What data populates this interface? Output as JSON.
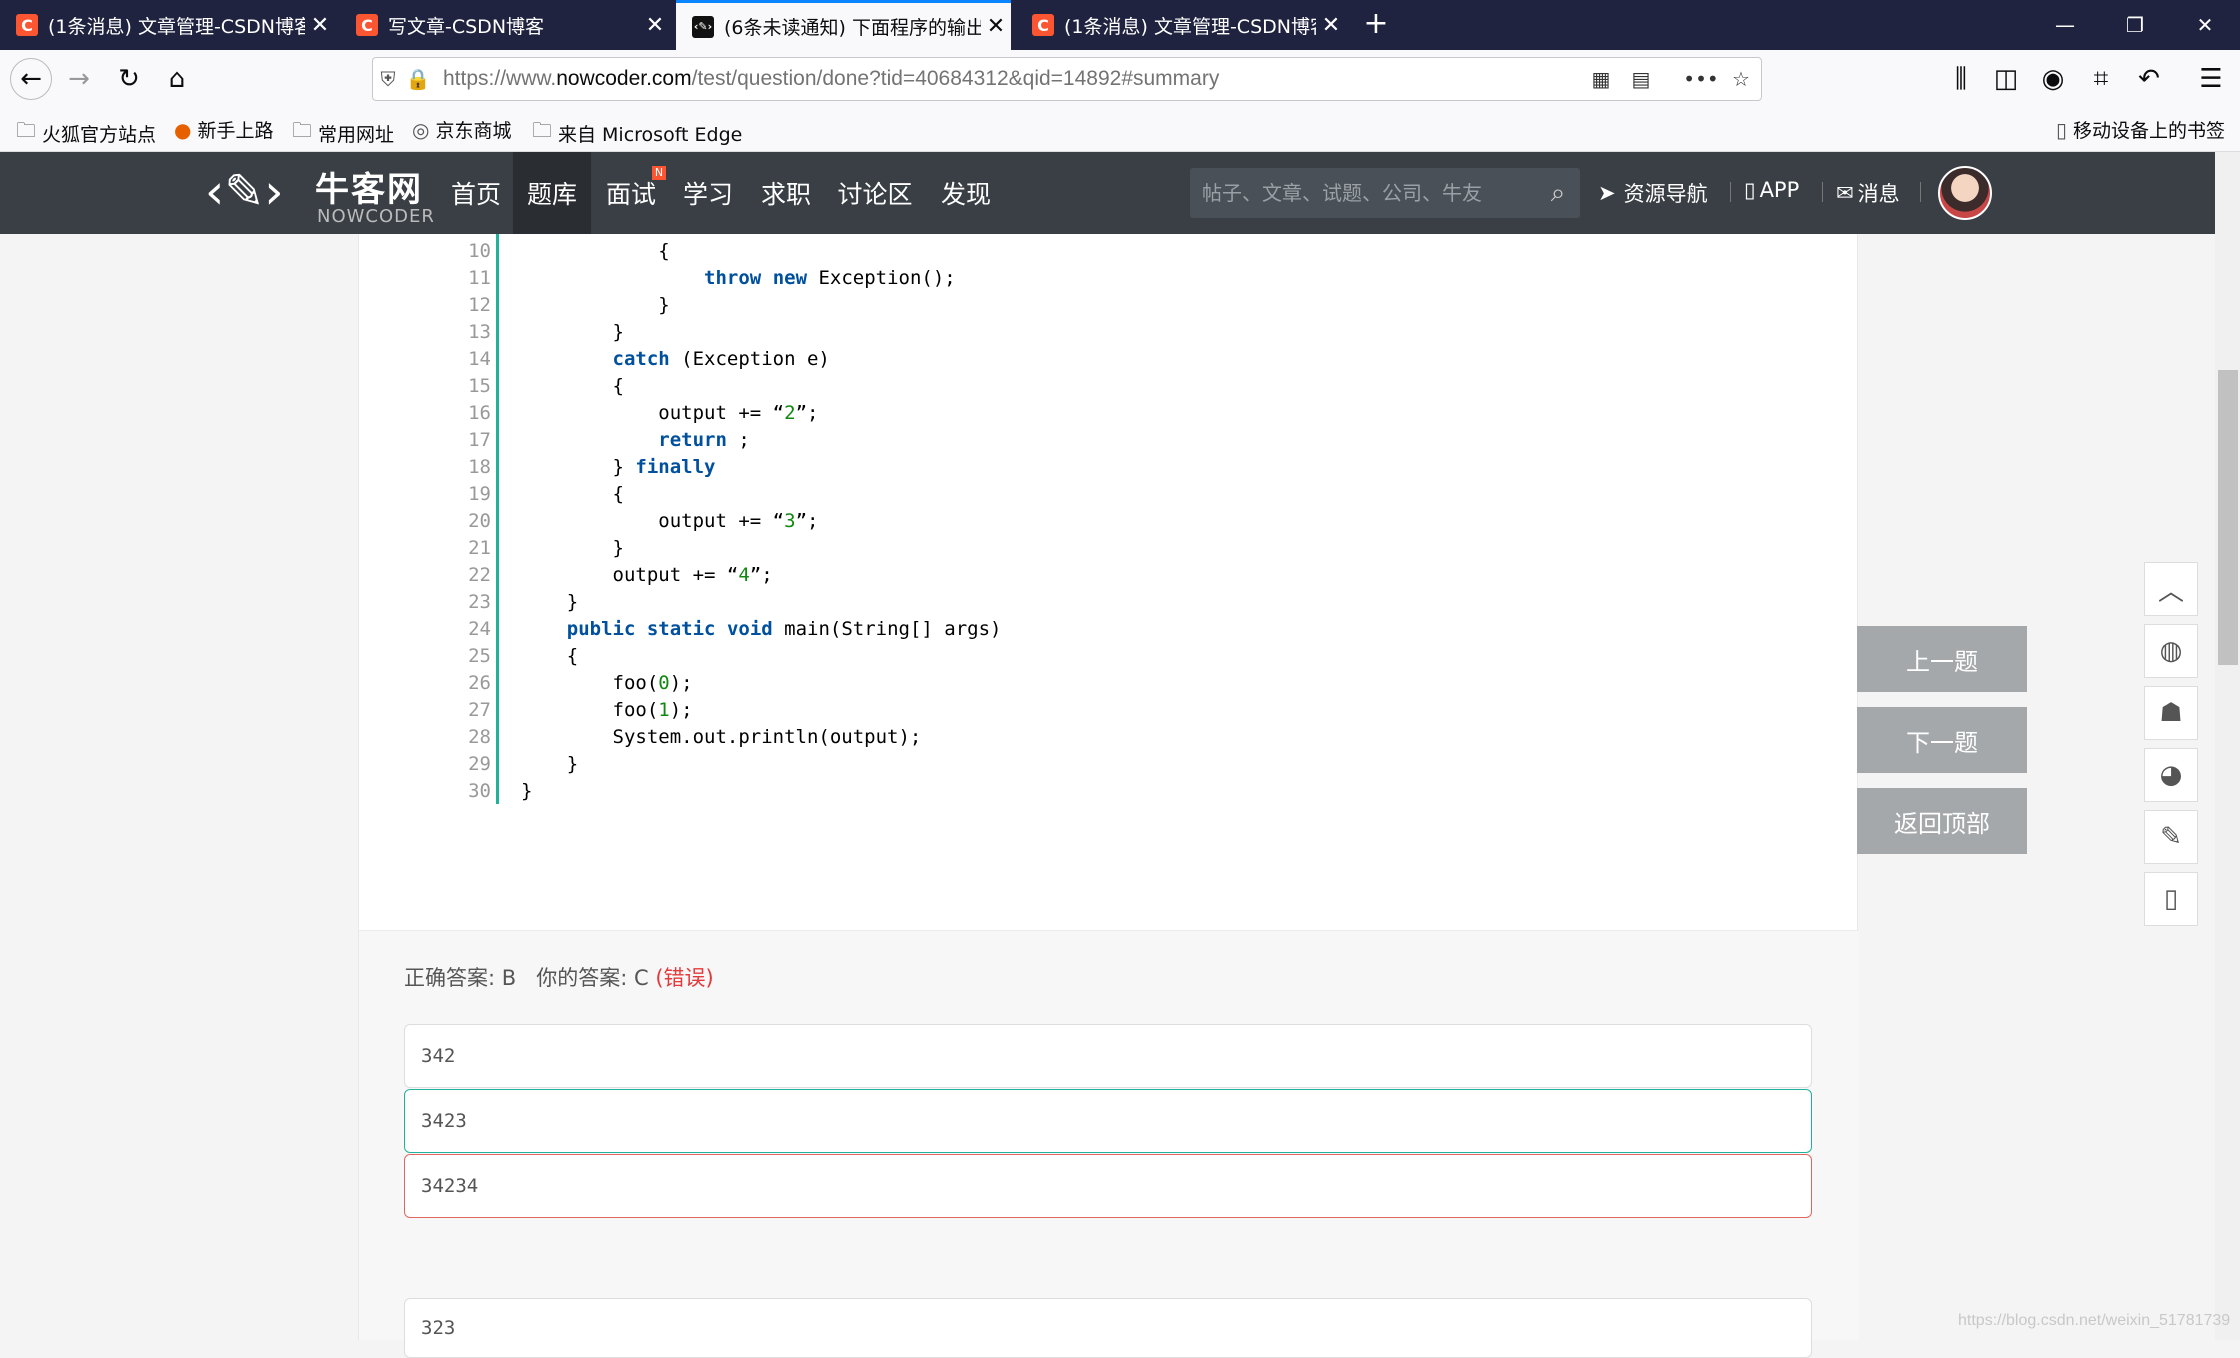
{
  "browser": {
    "tabs": [
      {
        "title": "(1条消息) 文章管理-CSDN博客",
        "icon": "C"
      },
      {
        "title": "写文章-CSDN博客",
        "icon": "C"
      },
      {
        "title": "(6条未读通知) 下面程序的输出",
        "icon": "nc"
      },
      {
        "title": "(1条消息) 文章管理-CSDN博客",
        "icon": "C"
      }
    ],
    "url_prefix": "https://www.",
    "url_domain": "nowcoder.com",
    "url_path": "/test/question/done?tid=40684312&qid=14892#summary",
    "bookmarks": [
      "火狐官方站点",
      "新手上路",
      "常用网址",
      "京东商城",
      "来自 Microsoft Edge"
    ],
    "mobile_bookmarks": "移动设备上的书签"
  },
  "site": {
    "logo_name": "牛客网",
    "logo_sub": "NOWCODER",
    "nav": [
      "首页",
      "题库",
      "面试",
      "学习",
      "求职",
      "讨论区",
      "发现"
    ],
    "nav_badge": "N",
    "search_placeholder": "帖子、文章、试题、公司、牛友",
    "resources": "资源导航",
    "app": "APP",
    "messages": "消息"
  },
  "code": {
    "lines": [
      {
        "n": "10",
        "html": "            {"
      },
      {
        "n": "11",
        "html": "                <span class=\"kw\">throw</span> <span class=\"kw\">new</span> Exception();"
      },
      {
        "n": "12",
        "html": "            }"
      },
      {
        "n": "13",
        "html": "        }"
      },
      {
        "n": "14",
        "html": "        <span class=\"kw\">catch</span> (Exception e)"
      },
      {
        "n": "15",
        "html": "        {"
      },
      {
        "n": "16",
        "html": "            output += “<span class=\"str\">2</span>”;"
      },
      {
        "n": "17",
        "html": "            <span class=\"kw\">return</span> ;"
      },
      {
        "n": "18",
        "html": "        } <span class=\"kw\">finally</span>"
      },
      {
        "n": "19",
        "html": "        {"
      },
      {
        "n": "20",
        "html": "            output += “<span class=\"str\">3</span>”;"
      },
      {
        "n": "21",
        "html": "        }"
      },
      {
        "n": "22",
        "html": "        output += “<span class=\"str\">4</span>”;"
      },
      {
        "n": "23",
        "html": "    }"
      },
      {
        "n": "24",
        "html": "    <span class=\"kw\">public</span> <span class=\"kw\">static</span> <span class=\"kw\">void</span> main(String[] args)"
      },
      {
        "n": "25",
        "html": "    {"
      },
      {
        "n": "26",
        "html": "        foo(<span class=\"num\">0</span>);"
      },
      {
        "n": "27",
        "html": "        foo(<span class=\"num\">1</span>);"
      },
      {
        "n": "28",
        "html": "        System.out.println(output);"
      },
      {
        "n": "29",
        "html": "    }"
      },
      {
        "n": "30",
        "html": "}"
      }
    ]
  },
  "answer": {
    "correct_label": "正确答案: B",
    "yours_label": "你的答案: C",
    "status": "(错误)"
  },
  "options": [
    "342",
    "3423",
    "34234",
    "323"
  ],
  "side": {
    "prev": "上一题",
    "next": "下一题",
    "top": "返回顶部"
  },
  "watermark": "https://blog.csdn.net/weixin_51781739"
}
